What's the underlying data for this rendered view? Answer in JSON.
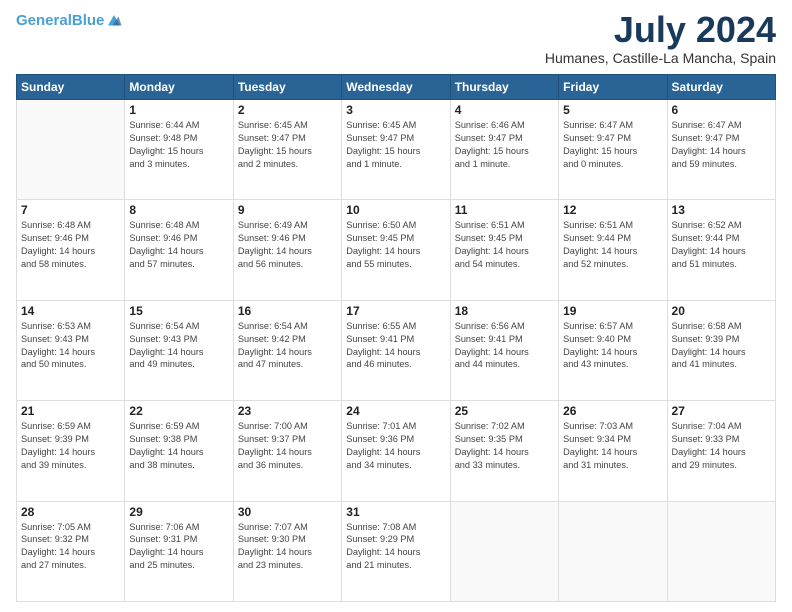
{
  "header": {
    "logo_line1": "General",
    "logo_line2": "Blue",
    "month": "July 2024",
    "location": "Humanes, Castille-La Mancha, Spain"
  },
  "weekdays": [
    "Sunday",
    "Monday",
    "Tuesday",
    "Wednesday",
    "Thursday",
    "Friday",
    "Saturday"
  ],
  "weeks": [
    [
      {
        "day": "",
        "info": ""
      },
      {
        "day": "1",
        "info": "Sunrise: 6:44 AM\nSunset: 9:48 PM\nDaylight: 15 hours\nand 3 minutes."
      },
      {
        "day": "2",
        "info": "Sunrise: 6:45 AM\nSunset: 9:47 PM\nDaylight: 15 hours\nand 2 minutes."
      },
      {
        "day": "3",
        "info": "Sunrise: 6:45 AM\nSunset: 9:47 PM\nDaylight: 15 hours\nand 1 minute."
      },
      {
        "day": "4",
        "info": "Sunrise: 6:46 AM\nSunset: 9:47 PM\nDaylight: 15 hours\nand 1 minute."
      },
      {
        "day": "5",
        "info": "Sunrise: 6:47 AM\nSunset: 9:47 PM\nDaylight: 15 hours\nand 0 minutes."
      },
      {
        "day": "6",
        "info": "Sunrise: 6:47 AM\nSunset: 9:47 PM\nDaylight: 14 hours\nand 59 minutes."
      }
    ],
    [
      {
        "day": "7",
        "info": "Sunrise: 6:48 AM\nSunset: 9:46 PM\nDaylight: 14 hours\nand 58 minutes."
      },
      {
        "day": "8",
        "info": "Sunrise: 6:48 AM\nSunset: 9:46 PM\nDaylight: 14 hours\nand 57 minutes."
      },
      {
        "day": "9",
        "info": "Sunrise: 6:49 AM\nSunset: 9:46 PM\nDaylight: 14 hours\nand 56 minutes."
      },
      {
        "day": "10",
        "info": "Sunrise: 6:50 AM\nSunset: 9:45 PM\nDaylight: 14 hours\nand 55 minutes."
      },
      {
        "day": "11",
        "info": "Sunrise: 6:51 AM\nSunset: 9:45 PM\nDaylight: 14 hours\nand 54 minutes."
      },
      {
        "day": "12",
        "info": "Sunrise: 6:51 AM\nSunset: 9:44 PM\nDaylight: 14 hours\nand 52 minutes."
      },
      {
        "day": "13",
        "info": "Sunrise: 6:52 AM\nSunset: 9:44 PM\nDaylight: 14 hours\nand 51 minutes."
      }
    ],
    [
      {
        "day": "14",
        "info": "Sunrise: 6:53 AM\nSunset: 9:43 PM\nDaylight: 14 hours\nand 50 minutes."
      },
      {
        "day": "15",
        "info": "Sunrise: 6:54 AM\nSunset: 9:43 PM\nDaylight: 14 hours\nand 49 minutes."
      },
      {
        "day": "16",
        "info": "Sunrise: 6:54 AM\nSunset: 9:42 PM\nDaylight: 14 hours\nand 47 minutes."
      },
      {
        "day": "17",
        "info": "Sunrise: 6:55 AM\nSunset: 9:41 PM\nDaylight: 14 hours\nand 46 minutes."
      },
      {
        "day": "18",
        "info": "Sunrise: 6:56 AM\nSunset: 9:41 PM\nDaylight: 14 hours\nand 44 minutes."
      },
      {
        "day": "19",
        "info": "Sunrise: 6:57 AM\nSunset: 9:40 PM\nDaylight: 14 hours\nand 43 minutes."
      },
      {
        "day": "20",
        "info": "Sunrise: 6:58 AM\nSunset: 9:39 PM\nDaylight: 14 hours\nand 41 minutes."
      }
    ],
    [
      {
        "day": "21",
        "info": "Sunrise: 6:59 AM\nSunset: 9:39 PM\nDaylight: 14 hours\nand 39 minutes."
      },
      {
        "day": "22",
        "info": "Sunrise: 6:59 AM\nSunset: 9:38 PM\nDaylight: 14 hours\nand 38 minutes."
      },
      {
        "day": "23",
        "info": "Sunrise: 7:00 AM\nSunset: 9:37 PM\nDaylight: 14 hours\nand 36 minutes."
      },
      {
        "day": "24",
        "info": "Sunrise: 7:01 AM\nSunset: 9:36 PM\nDaylight: 14 hours\nand 34 minutes."
      },
      {
        "day": "25",
        "info": "Sunrise: 7:02 AM\nSunset: 9:35 PM\nDaylight: 14 hours\nand 33 minutes."
      },
      {
        "day": "26",
        "info": "Sunrise: 7:03 AM\nSunset: 9:34 PM\nDaylight: 14 hours\nand 31 minutes."
      },
      {
        "day": "27",
        "info": "Sunrise: 7:04 AM\nSunset: 9:33 PM\nDaylight: 14 hours\nand 29 minutes."
      }
    ],
    [
      {
        "day": "28",
        "info": "Sunrise: 7:05 AM\nSunset: 9:32 PM\nDaylight: 14 hours\nand 27 minutes."
      },
      {
        "day": "29",
        "info": "Sunrise: 7:06 AM\nSunset: 9:31 PM\nDaylight: 14 hours\nand 25 minutes."
      },
      {
        "day": "30",
        "info": "Sunrise: 7:07 AM\nSunset: 9:30 PM\nDaylight: 14 hours\nand 23 minutes."
      },
      {
        "day": "31",
        "info": "Sunrise: 7:08 AM\nSunset: 9:29 PM\nDaylight: 14 hours\nand 21 minutes."
      },
      {
        "day": "",
        "info": ""
      },
      {
        "day": "",
        "info": ""
      },
      {
        "day": "",
        "info": ""
      }
    ]
  ]
}
